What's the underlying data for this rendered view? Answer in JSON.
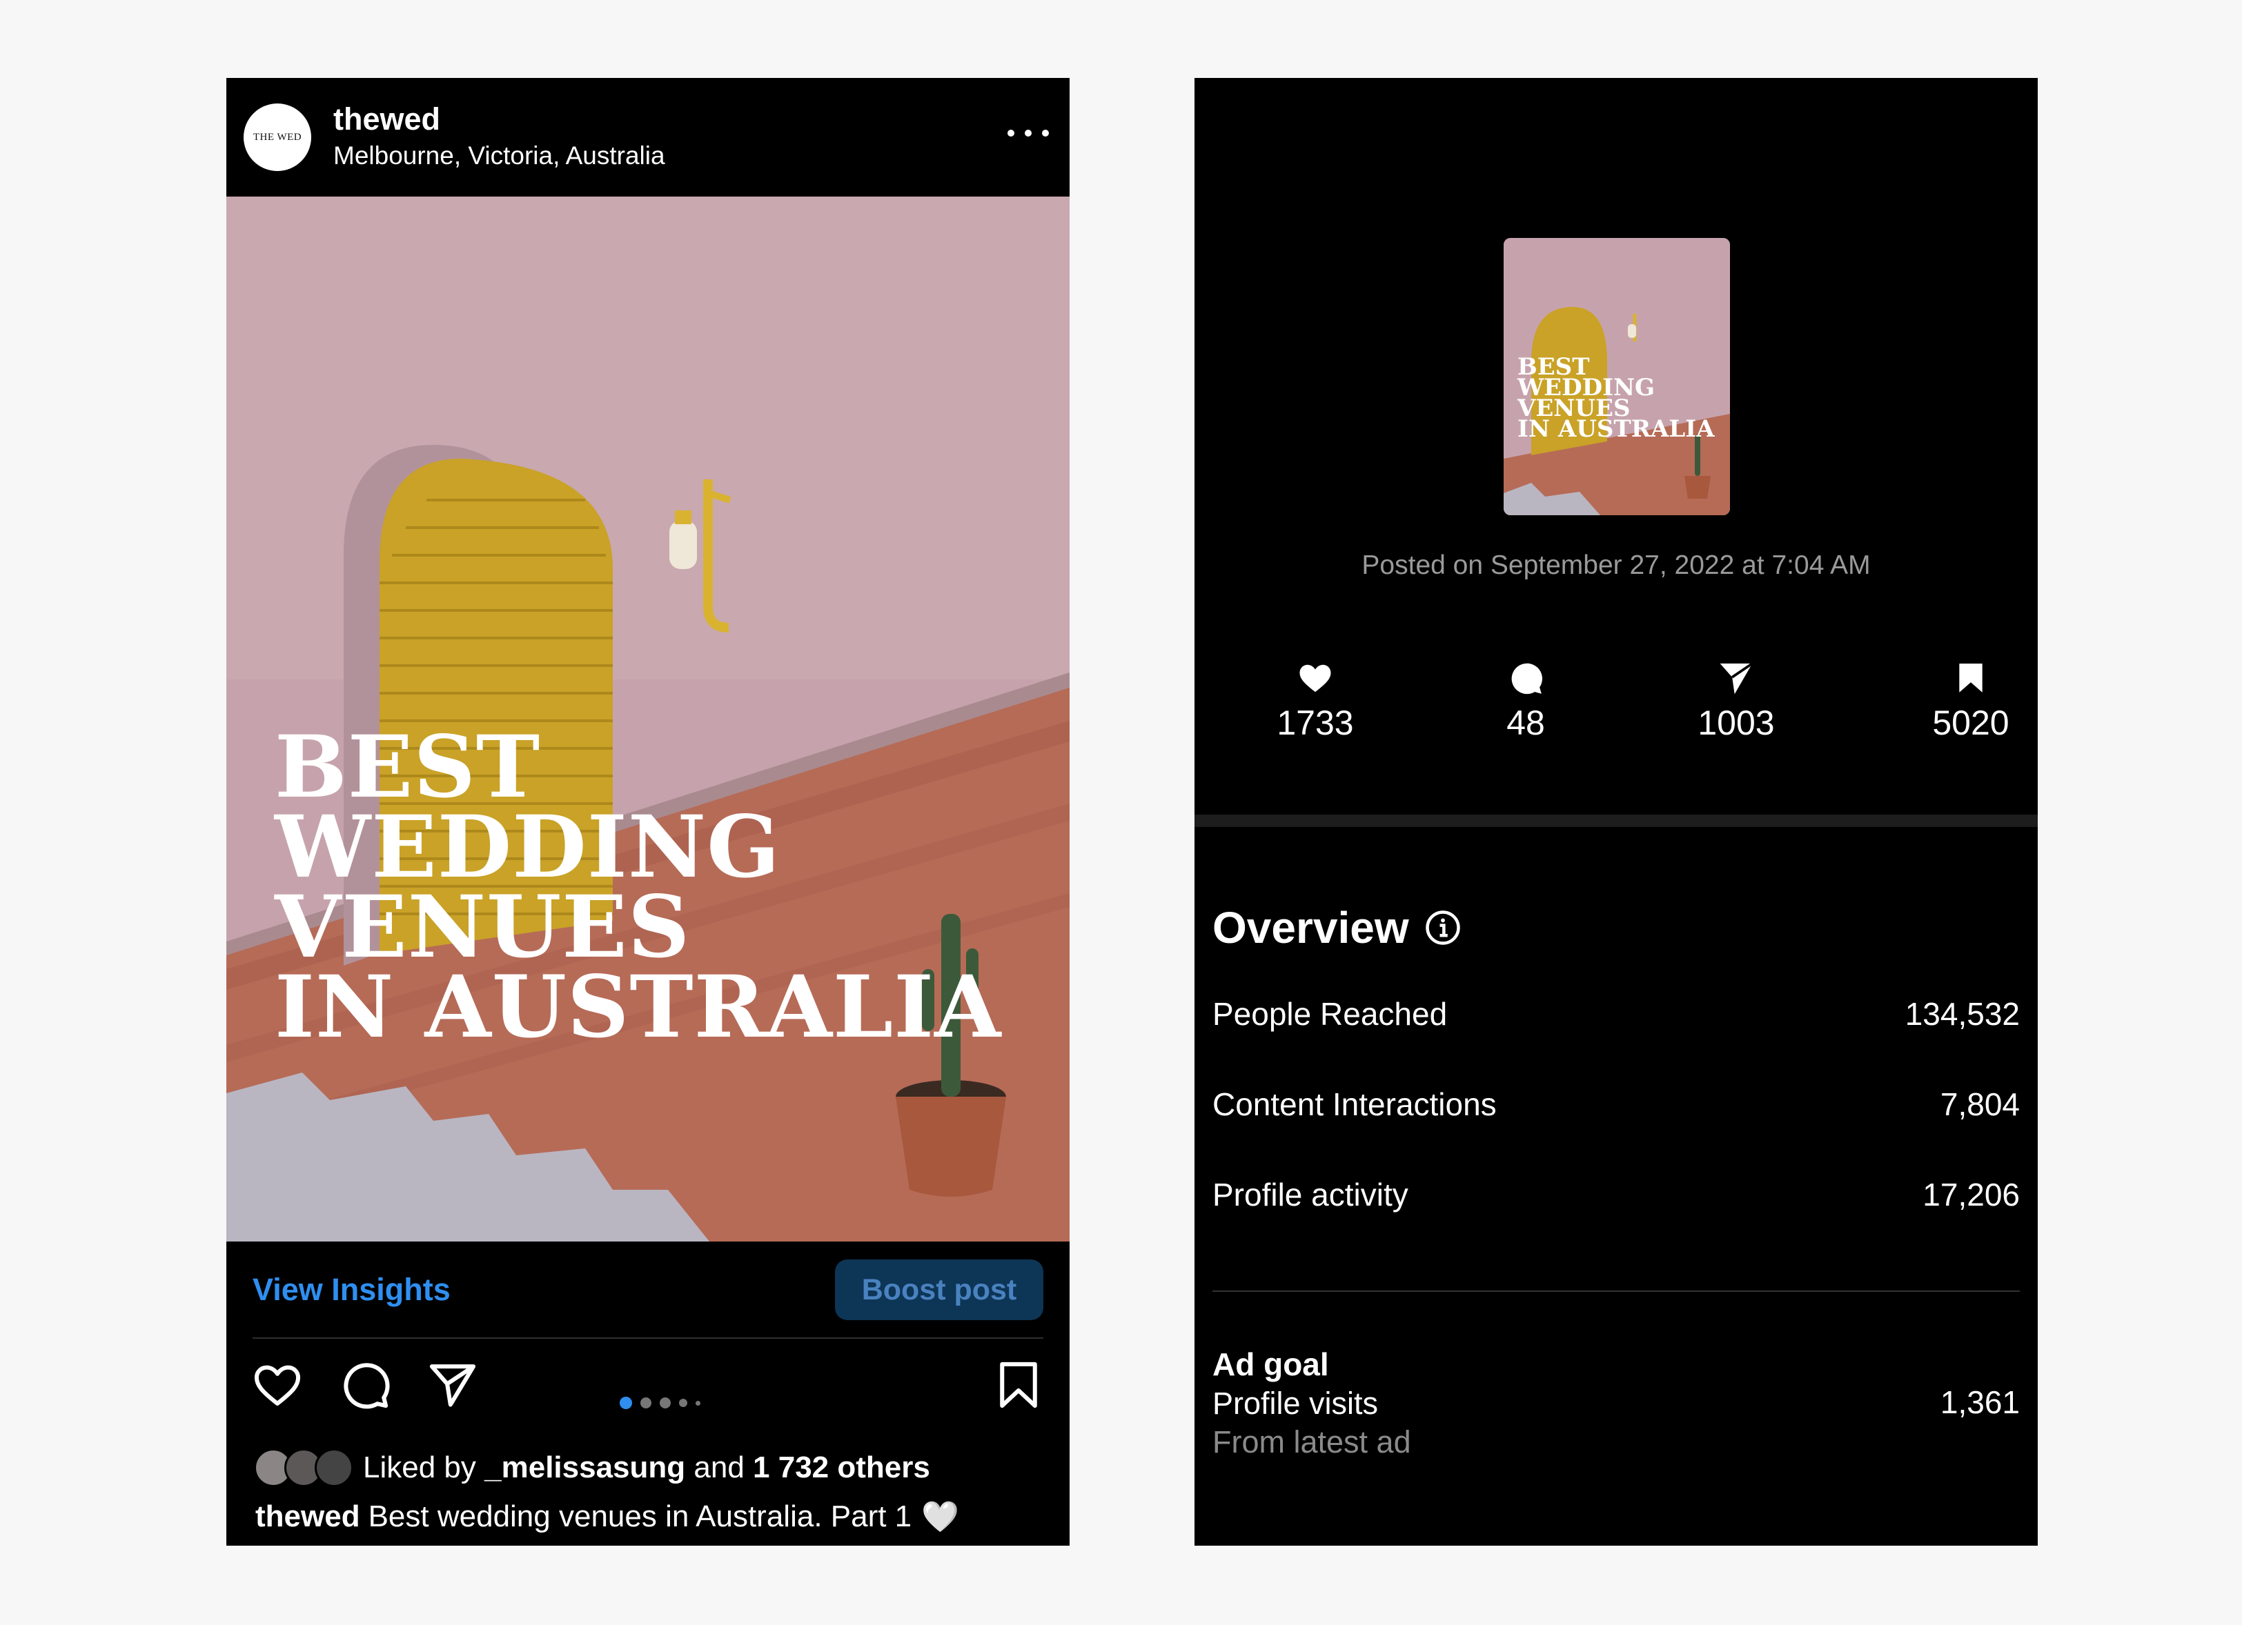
{
  "post": {
    "avatar_text": "THE WED",
    "username": "thewed",
    "location": "Melbourne, Victoria, Australia",
    "headline": [
      "BEST",
      "WEDDING",
      "VENUES",
      "IN AUSTRALIA"
    ],
    "view_insights_label": "View Insights",
    "boost_label": "Boost post",
    "carousel": {
      "count": 5,
      "active_index": 0
    },
    "likes": {
      "prefix": "Liked by",
      "user": "_melissasung",
      "middle": "and",
      "others": "1 732 others"
    },
    "caption": {
      "user": "thewed",
      "text": "Best wedding venues in Australia. Part 1",
      "emoji": "🤍"
    },
    "icons": [
      "heart-icon",
      "comment-icon",
      "share-icon",
      "bookmark-icon",
      "more-icon"
    ]
  },
  "insights": {
    "thumbnail_headline": [
      "BEST",
      "WEDDING",
      "VENUES",
      "IN AUSTRALIA"
    ],
    "posted_on": "Posted on September 27, 2022 at 7:04 AM",
    "stats": [
      {
        "icon": "heart-icon",
        "value": "1733"
      },
      {
        "icon": "comment-icon",
        "value": "48"
      },
      {
        "icon": "share-icon",
        "value": "1003"
      },
      {
        "icon": "bookmark-icon",
        "value": "5020"
      }
    ],
    "overview_title": "Overview",
    "metrics": [
      {
        "label": "People Reached",
        "value": "134,532"
      },
      {
        "label": "Content Interactions",
        "value": "7,804"
      },
      {
        "label": "Profile activity",
        "value": "17,206"
      }
    ],
    "ad_goal": {
      "title": "Ad goal",
      "label": "Profile visits",
      "sublabel": "From latest ad",
      "value": "1,361"
    }
  },
  "colors": {
    "link_blue": "#2e8ff0",
    "boost_bg": "#0d3556",
    "wall_pink": "#c8a6ae",
    "door_yellow": "#c9a227",
    "brick": "#b86a55"
  }
}
